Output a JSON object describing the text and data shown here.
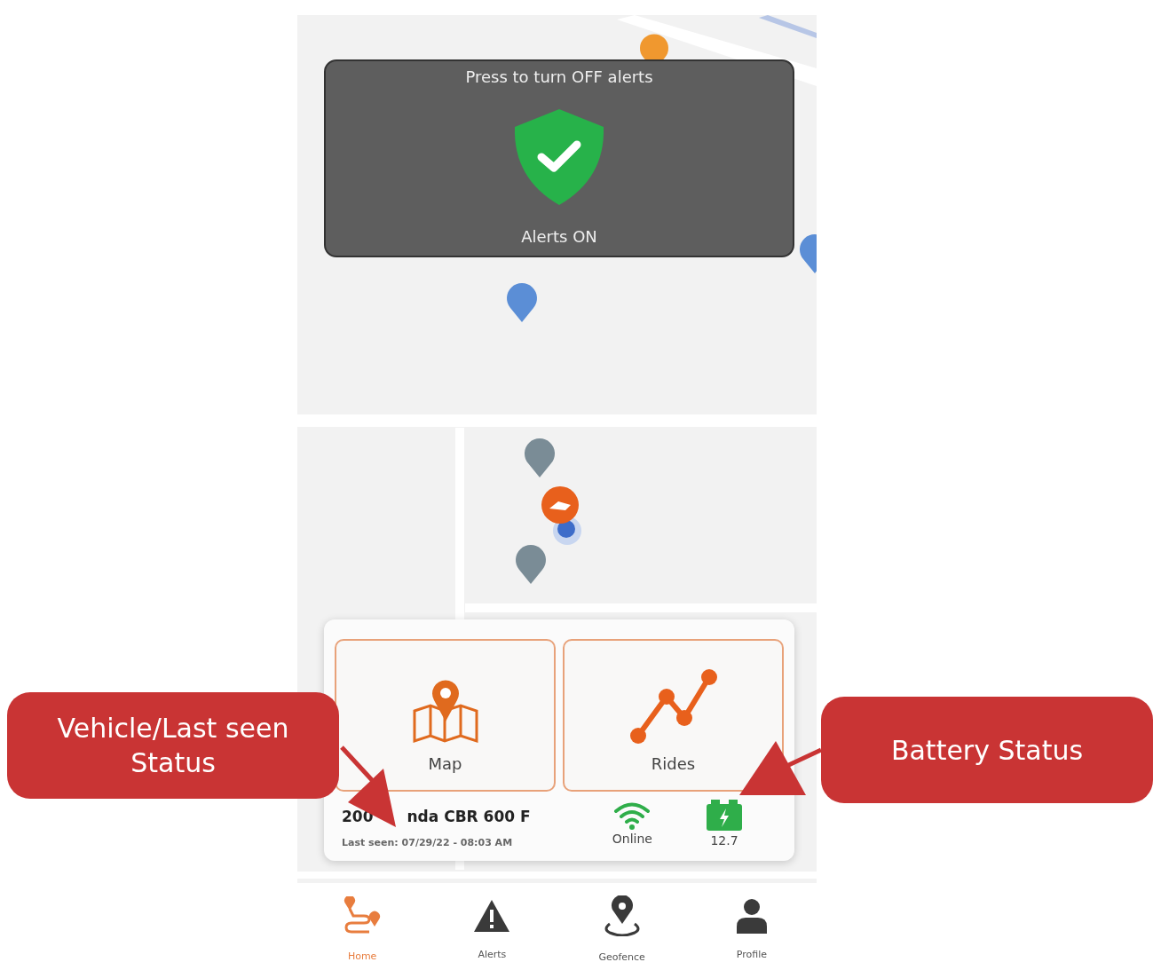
{
  "alerts_overlay": {
    "prompt": "Press to turn OFF alerts",
    "alerts_on": true,
    "status": "Alerts ON"
  },
  "tiles": [
    {
      "label": "Map"
    },
    {
      "label": "Rides"
    }
  ],
  "vehicle": {
    "name_parts": [
      "200",
      "nda CBR 600 F"
    ],
    "last_seen": "Last seen: 07/29/22 - 08:03 AM",
    "online": true,
    "connection": "Online",
    "battery": "12.7"
  },
  "nav": [
    {
      "label": "Home",
      "selected": true
    },
    {
      "label": "Alerts",
      "selected": false
    },
    {
      "label": "Geofence",
      "selected": false
    },
    {
      "label": "Profile",
      "selected": false
    }
  ],
  "callouts": [
    {
      "text": "Vehicle/Last seen Status"
    },
    {
      "text": "Battery Status"
    }
  ]
}
